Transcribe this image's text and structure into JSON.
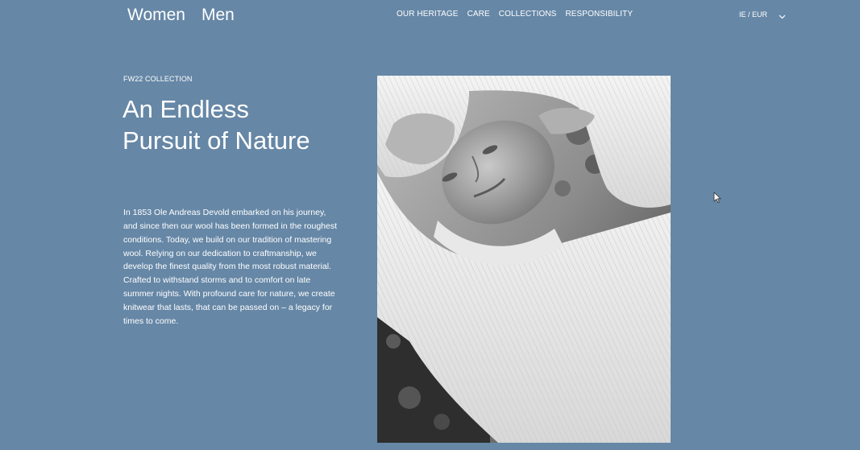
{
  "header": {
    "gender_links": [
      {
        "label": "Women"
      },
      {
        "label": "Men"
      }
    ],
    "nav_items": [
      {
        "label": "OUR HERITAGE"
      },
      {
        "label": "CARE"
      },
      {
        "label": "COLLECTIONS"
      },
      {
        "label": "RESPONSIBILITY"
      }
    ],
    "locale": {
      "label": "IE / EUR",
      "icon": "chevron-down-icon"
    }
  },
  "hero": {
    "eyebrow": "FW22 COLLECTION",
    "title": "An Endless Pursuit of Nature",
    "body": "In 1853 Ole Andreas Devold embarked on his journey, and since then our wool has been formed in the roughest conditions. Today, we build on our tradition of mastering wool. Relying on our dedication to craftmanship, we develop the finest quality from the most robust material. Crafted to withstand storms and to comfort on late summer nights. With profound care for nature, we create knitwear that lasts, that can be passed on – a legacy for times to come."
  },
  "colors": {
    "background": "#6687a6",
    "text": "#ffffff"
  }
}
